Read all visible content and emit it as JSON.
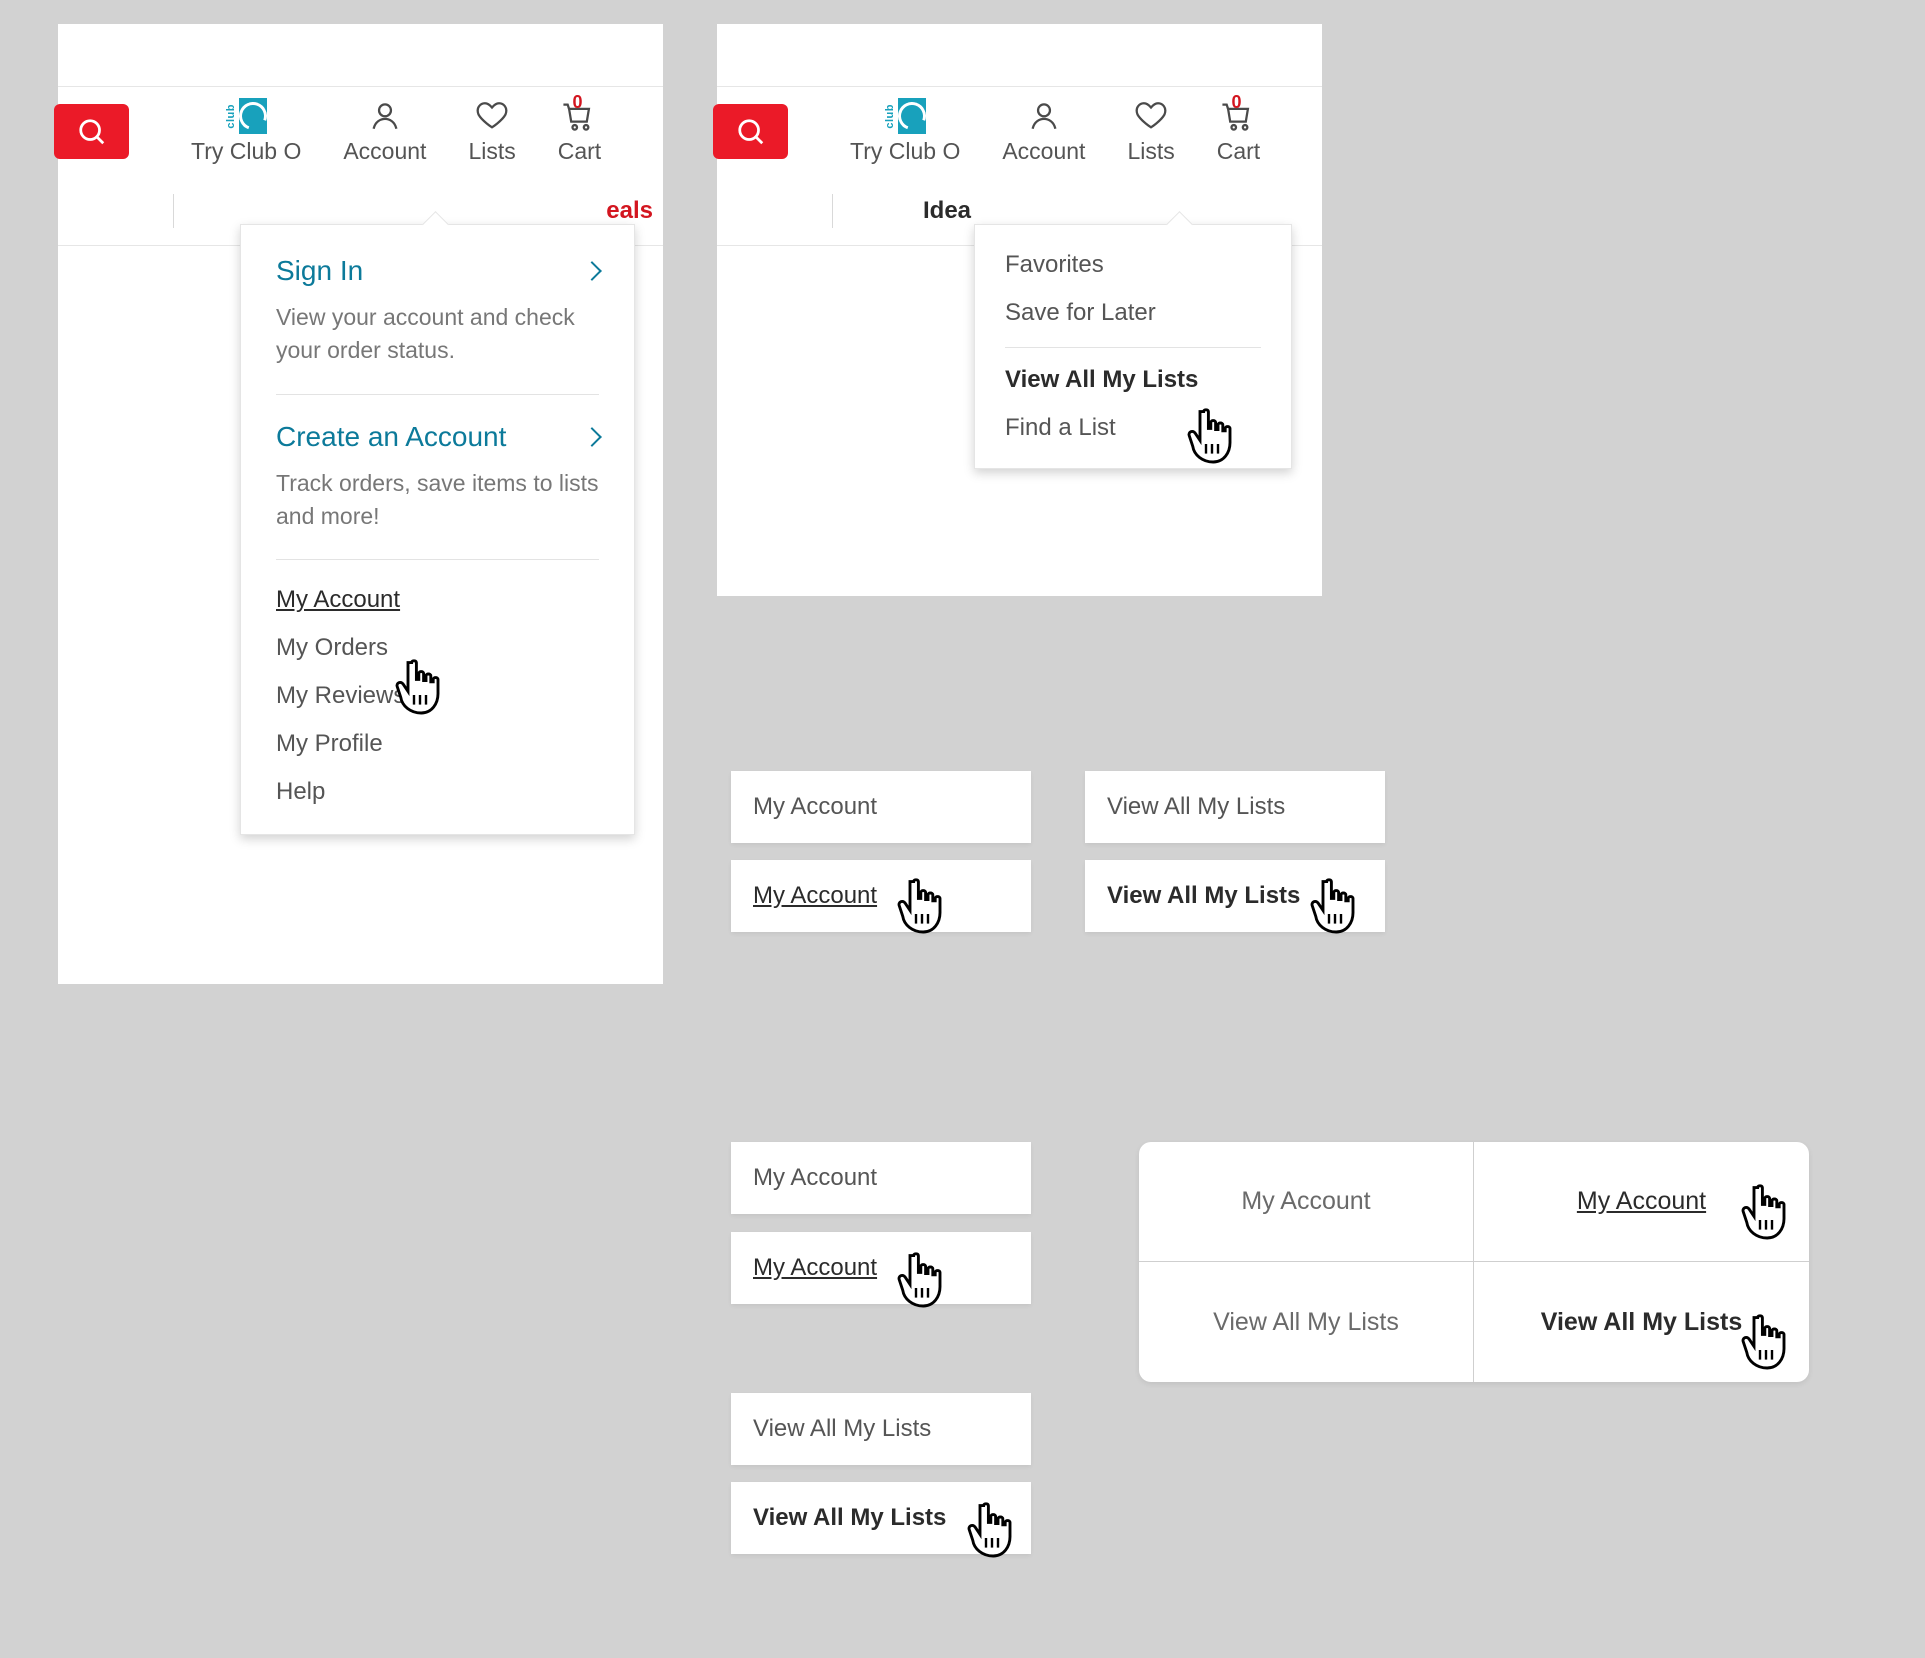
{
  "nav": {
    "try_club_o": "Try Club O",
    "account": "Account",
    "lists": "Lists",
    "cart": "Cart",
    "cart_count": "0"
  },
  "subnav": {
    "deals_fragment": "eals",
    "idea_fragment": "Idea"
  },
  "account_dropdown": {
    "sign_in": "Sign In",
    "sign_in_desc": "View your account and check your order status.",
    "create": "Create an Account",
    "create_desc": "Track orders, save items to lists and more!",
    "links": {
      "my_account": "My Account",
      "my_orders": "My Orders",
      "my_reviews": "My Reviews",
      "my_profile": "My Profile",
      "help": "Help"
    }
  },
  "lists_dropdown": {
    "favorites": "Favorites",
    "save_for_later": "Save for Later",
    "view_all": "View All My Lists",
    "find_a_list": "Find a List"
  },
  "demo": {
    "my_account": "My Account",
    "view_all_my_lists": "View All My Lists"
  }
}
